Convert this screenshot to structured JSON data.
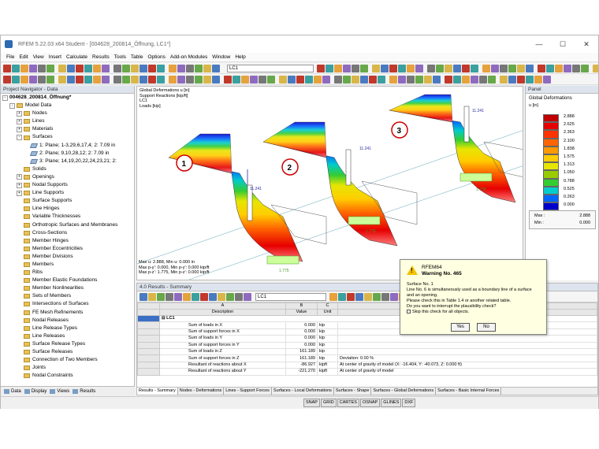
{
  "window": {
    "title": "RFEM 5.22.03 x64 Student - [004628_200814_Öffnung, LC1*]",
    "controls": [
      "—",
      "☐",
      "✕"
    ]
  },
  "menu": [
    "File",
    "Edit",
    "View",
    "Insert",
    "Calculate",
    "Results",
    "Tools",
    "Table",
    "Options",
    "Add-on Modules",
    "Window",
    "Help"
  ],
  "toolbar": {
    "load_case": "LC1"
  },
  "navigator": {
    "title": "Project Navigator - Data",
    "tabs": [
      "Data",
      "Display",
      "Views",
      "Results"
    ],
    "items": [
      {
        "label": "004628_200814_Öffnung*",
        "level": 0,
        "exp": "-",
        "bold": true
      },
      {
        "label": "Model Data",
        "level": 1,
        "exp": "-",
        "type": "folder"
      },
      {
        "label": "Nodes",
        "level": 2,
        "exp": "+",
        "type": "folder"
      },
      {
        "label": "Lines",
        "level": 2,
        "exp": "+",
        "type": "folder"
      },
      {
        "label": "Materials",
        "level": 2,
        "exp": "+",
        "type": "folder"
      },
      {
        "label": "Surfaces",
        "level": 2,
        "exp": "-",
        "type": "folder"
      },
      {
        "label": "1: Plane; 1-3,29,6,17,4; 2: 7.09 in",
        "level": 3,
        "type": "plane"
      },
      {
        "label": "2: Plane; 9,10,28,12; 2: 7.09 in",
        "level": 3,
        "type": "plane"
      },
      {
        "label": "3: Plane; 14,19,20,22,24,23,21; 2:",
        "level": 3,
        "type": "plane"
      },
      {
        "label": "Solids",
        "level": 2,
        "type": "folder"
      },
      {
        "label": "Openings",
        "level": 2,
        "exp": "+",
        "type": "folder"
      },
      {
        "label": "Nodal Supports",
        "level": 2,
        "exp": "+",
        "type": "folder"
      },
      {
        "label": "Line Supports",
        "level": 2,
        "exp": "+",
        "type": "folder"
      },
      {
        "label": "Surface Supports",
        "level": 2,
        "type": "folder"
      },
      {
        "label": "Line Hinges",
        "level": 2,
        "type": "folder"
      },
      {
        "label": "Variable Thicknesses",
        "level": 2,
        "type": "folder"
      },
      {
        "label": "Orthotropic Surfaces and Membranes",
        "level": 2,
        "type": "folder"
      },
      {
        "label": "Cross-Sections",
        "level": 2,
        "type": "folder"
      },
      {
        "label": "Member Hinges",
        "level": 2,
        "type": "folder"
      },
      {
        "label": "Member Eccentricities",
        "level": 2,
        "type": "folder"
      },
      {
        "label": "Member Divisions",
        "level": 2,
        "type": "folder"
      },
      {
        "label": "Members",
        "level": 2,
        "type": "folder"
      },
      {
        "label": "Ribs",
        "level": 2,
        "type": "folder"
      },
      {
        "label": "Member Elastic Foundations",
        "level": 2,
        "type": "folder"
      },
      {
        "label": "Member Nonlinearities",
        "level": 2,
        "type": "folder"
      },
      {
        "label": "Sets of Members",
        "level": 2,
        "type": "folder"
      },
      {
        "label": "Intersections of Surfaces",
        "level": 2,
        "type": "folder"
      },
      {
        "label": "FE Mesh Refinements",
        "level": 2,
        "type": "folder"
      },
      {
        "label": "Nodal Releases",
        "level": 2,
        "type": "folder"
      },
      {
        "label": "Line Release Types",
        "level": 2,
        "type": "folder"
      },
      {
        "label": "Line Releases",
        "level": 2,
        "type": "folder"
      },
      {
        "label": "Surface Release Types",
        "level": 2,
        "type": "folder"
      },
      {
        "label": "Surface Releases",
        "level": 2,
        "type": "folder"
      },
      {
        "label": "Connection of Two Members",
        "level": 2,
        "type": "folder"
      },
      {
        "label": "Joints",
        "level": 2,
        "type": "folder"
      },
      {
        "label": "Nodal Constraints",
        "level": 2,
        "type": "folder"
      }
    ]
  },
  "viewport": {
    "info": [
      "Global Deformations u [in]",
      "Support Reactions [kip/ft]",
      "LC1",
      "Loads [kip]"
    ],
    "footer": [
      "Max u: 2.888, Min u: 0.000 in",
      "Max p-y': 0.000, Min p-y': 0.000 kip/ft",
      "Max p-z': 1.775, Min p-z': 0.000 kip/ft"
    ],
    "callouts": [
      "1",
      "2",
      "3"
    ],
    "load_value": "11.241",
    "support_value": "1.775"
  },
  "panel": {
    "title": "Panel",
    "subtitle": "Global Deformations",
    "unit": "u [in]",
    "legend_values": [
      "2.888",
      "2.625",
      "2.363",
      "2.100",
      "1.838",
      "1.575",
      "1.313",
      "1.050",
      "0.788",
      "0.525",
      "0.263",
      "0.000"
    ],
    "legend_colors": [
      "#c00000",
      "#e60000",
      "#ff3300",
      "#ff6600",
      "#ff9900",
      "#ffcc00",
      "#e6e600",
      "#99cc00",
      "#33cc33",
      "#00cccc",
      "#0066ff",
      "#0000cc"
    ],
    "max_label": "Max :",
    "max_value": "2.888",
    "min_label": "Min :",
    "min_value": "0.000"
  },
  "results": {
    "title": "4.0 Results - Summary",
    "load_case": "LC1",
    "col_letters": [
      "A",
      "B",
      "C",
      "D"
    ],
    "headers": [
      "Description",
      "Value",
      "Unit",
      "Comment"
    ],
    "group": "LC1",
    "rows": [
      {
        "d": "Sum of loads in X",
        "v": "0.000",
        "u": "kip",
        "c": ""
      },
      {
        "d": "Sum of support forces in X",
        "v": "0.000",
        "u": "kip",
        "c": ""
      },
      {
        "d": "Sum of loads in Y",
        "v": "0.000",
        "u": "kip",
        "c": ""
      },
      {
        "d": "Sum of support forces in Y",
        "v": "0.000",
        "u": "kip",
        "c": ""
      },
      {
        "d": "Sum of loads in Z",
        "v": "161.189",
        "u": "kip",
        "c": ""
      },
      {
        "d": "Sum of support forces in Z",
        "v": "161.189",
        "u": "kip",
        "c": "Deviation:  0.00 %"
      },
      {
        "d": "Resultant of reactions about X",
        "v": "-86.927",
        "u": "kipft",
        "c": "At center of gravity of model (X: -16.404, Y: -40.073, Z: 0.000 ft)"
      },
      {
        "d": "Resultant of reactions about Y",
        "v": "-221.270",
        "u": "kipft",
        "c": "At center of gravity of model"
      }
    ],
    "tabs": [
      "Results - Summary",
      "Nodes - Deformations",
      "Lines - Support Forces",
      "Surfaces - Local Deformations",
      "Surfaces - Shape",
      "Surfaces - Global Deformations",
      "Surfaces - Basic Internal Forces"
    ]
  },
  "status": [
    "SNAP",
    "GRID",
    "CARTES",
    "OSNAP",
    "GLINES",
    "DXF"
  ],
  "dialog": {
    "title": "RFEM64",
    "heading": "Warning No. 465",
    "lines": [
      "Surface No. 1",
      "Line No. 6 is simultaneously used as a boundary line of a surface",
      "and an opening.",
      "Please check this in Table 1.4 or another related table.",
      "Do you want to interrupt the plausibility check?"
    ],
    "checkbox": "Skip this check for all objects.",
    "yes": "Yes",
    "no": "No"
  }
}
